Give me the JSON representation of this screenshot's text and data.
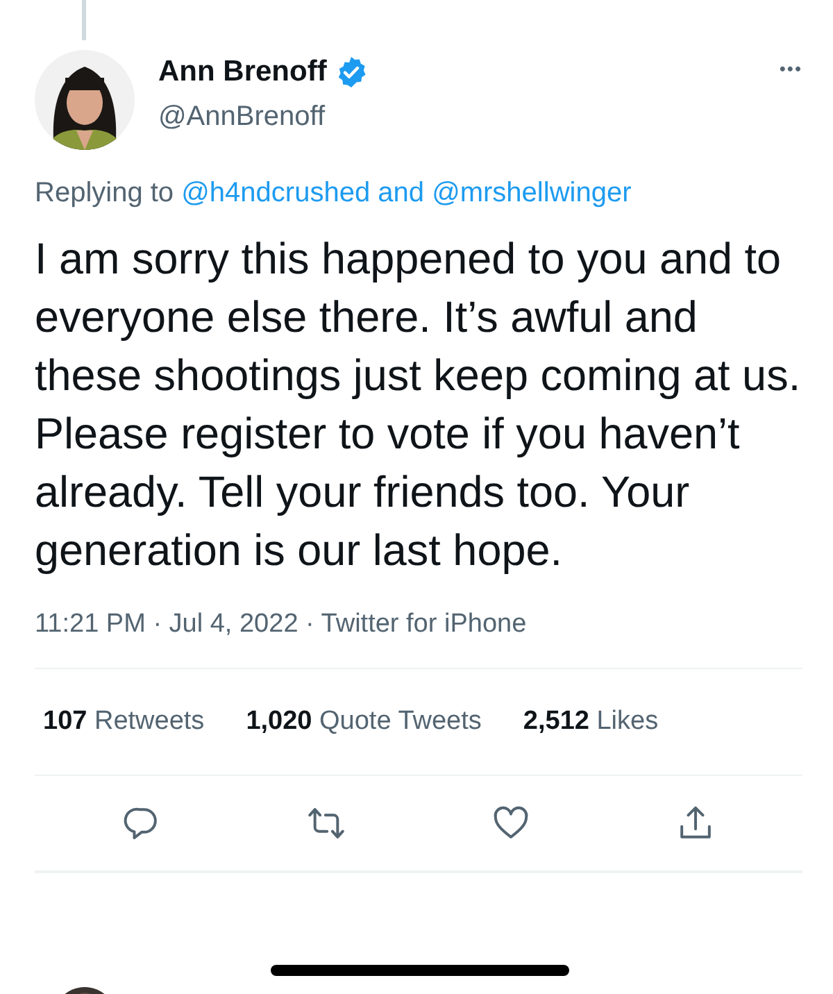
{
  "author": {
    "name": "Ann Brenoff",
    "verified": true,
    "handle": "@AnnBrenoff"
  },
  "more_menu": "•••",
  "reply_context": {
    "label": "Replying to",
    "mentions": [
      "@h4ndcrushed",
      "@mrshellwinger"
    ],
    "joiner": "and"
  },
  "body": "I am sorry this happened to you and to everyone else there. It’s awful and these shootings just keep coming at us. Please register to vote if you haven’t already. Tell your friends too. Your generation is our last hope.",
  "meta": {
    "time": "11:21 PM",
    "date": "Jul 4, 2022",
    "source": "Twitter for iPhone",
    "separator": "·"
  },
  "stats": [
    {
      "count": "107",
      "label": "Retweets"
    },
    {
      "count": "1,020",
      "label": "Quote Tweets"
    },
    {
      "count": "2,512",
      "label": "Likes"
    }
  ],
  "actions": [
    {
      "kind": "reply"
    },
    {
      "kind": "retweet"
    },
    {
      "kind": "like"
    },
    {
      "kind": "share"
    }
  ]
}
